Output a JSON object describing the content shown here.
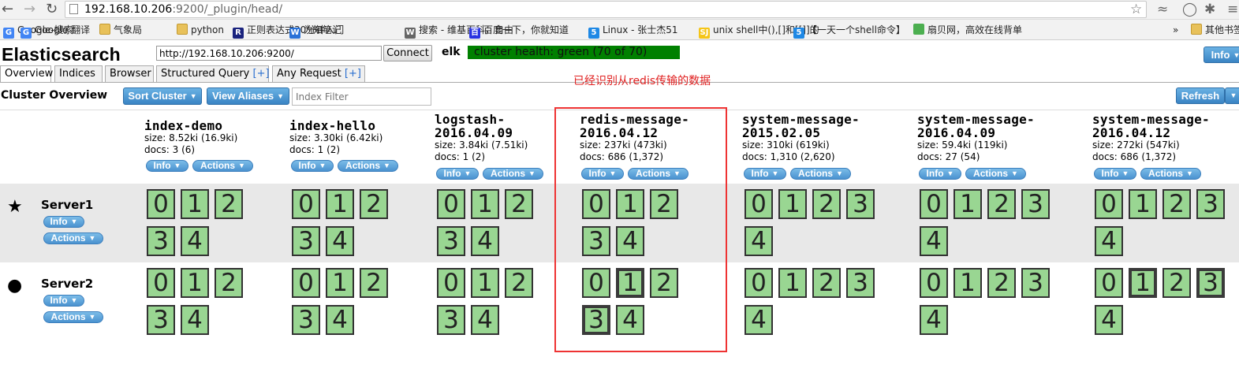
{
  "browser": {
    "url_host": "192.168.10.206",
    "url_rest": ":9200/_plugin/head/",
    "bookmarks": [
      {
        "label": "Google-搜索",
        "icon": "G",
        "color": "#4285f4"
      },
      {
        "label": "Google 翻译",
        "icon": "G",
        "color": "#4285f4"
      },
      {
        "label": "气象局",
        "icon": "",
        "color": "folder"
      },
      {
        "label": "python",
        "icon": "",
        "color": "folder"
      },
      {
        "label": "正则表达式30分钟入门",
        "icon": "R",
        "color": "#1a237e"
      },
      {
        "label": "为知笔记",
        "icon": "W",
        "color": "#2a72d8"
      },
      {
        "label": "搜索 - 维基百科，自由",
        "icon": "W",
        "color": "#666666"
      },
      {
        "label": "百度一下，你就知道",
        "icon": "百",
        "color": "#2932e1"
      },
      {
        "label": "Linux - 张士杰51",
        "icon": "5",
        "color": "#1e88e5"
      },
      {
        "label": "unix shell中(),[]和[[]]的",
        "icon": "SJ",
        "color": "#f5c518"
      },
      {
        "label": "【一天一个shell命令】",
        "icon": "5",
        "color": "#1e88e5"
      },
      {
        "label": "扇贝网，高效在线背单",
        "icon": "",
        "color": "#4caf50"
      },
      {
        "label": "»",
        "icon": "",
        "color": ""
      },
      {
        "label": "其他书签",
        "icon": "",
        "color": "folder"
      }
    ]
  },
  "header": {
    "title": "Elasticsearch",
    "connect_url": "http://192.168.10.206:9200/",
    "connect_label": "Connect",
    "cluster_name": "elk",
    "health": "cluster health: green (70 of 70)",
    "info_label": "Info"
  },
  "tabs": [
    {
      "label": "Overview",
      "plus": ""
    },
    {
      "label": "Indices",
      "plus": ""
    },
    {
      "label": "Browser",
      "plus": ""
    },
    {
      "label": "Structured Query ",
      "plus": "[+]"
    },
    {
      "label": "Any Request ",
      "plus": "[+]"
    }
  ],
  "annotation": "已经识别从redis传输的数据",
  "overview": {
    "title": "Cluster Overview",
    "sort_label": "Sort Cluster",
    "aliases_label": "View Aliases",
    "filter_placeholder": "Index Filter",
    "refresh_label": "Refresh"
  },
  "index_buttons": {
    "info": "Info",
    "actions": "Actions"
  },
  "indices": [
    {
      "name": "index-demo",
      "size": "size: 8.52ki (16.9ki)",
      "docs": "docs: 3 (6)",
      "shards": 5,
      "primary_s1": [],
      "primary_s2": []
    },
    {
      "name": "index-hello",
      "size": "size: 3.30ki (6.42ki)",
      "docs": "docs: 1 (2)",
      "shards": 5,
      "primary_s1": [],
      "primary_s2": []
    },
    {
      "name": "logstash-\n2016.04.09",
      "size": "size: 3.84ki (7.51ki)",
      "docs": "docs: 1 (2)",
      "shards": 5,
      "primary_s1": [],
      "primary_s2": []
    },
    {
      "name": "redis-message-\n2016.04.12",
      "size": "size: 237ki (473ki)",
      "docs": "docs: 686 (1,372)",
      "shards": 5,
      "primary_s1": [],
      "primary_s2": [
        1,
        3
      ]
    },
    {
      "name": "system-message-\n2015.02.05",
      "size": "size: 310ki (619ki)",
      "docs": "docs: 1,310 (2,620)",
      "shards": 5,
      "primary_s1": [],
      "primary_s2": []
    },
    {
      "name": "system-message-\n2016.04.09",
      "size": "size: 59.4ki (119ki)",
      "docs": "docs: 27 (54)",
      "shards": 5,
      "primary_s1": [],
      "primary_s2": []
    },
    {
      "name": "system-message-\n2016.04.12",
      "size": "size: 272ki (547ki)",
      "docs": "docs: 686 (1,372)",
      "shards": 5,
      "primary_s1": [],
      "primary_s2": [
        1,
        3
      ]
    }
  ],
  "servers": [
    {
      "name": "Server1",
      "icon": "star-icon",
      "info": "Info",
      "actions": "Actions"
    },
    {
      "name": "Server2",
      "icon": "circle-icon",
      "info": "Info",
      "actions": "Actions"
    }
  ]
}
